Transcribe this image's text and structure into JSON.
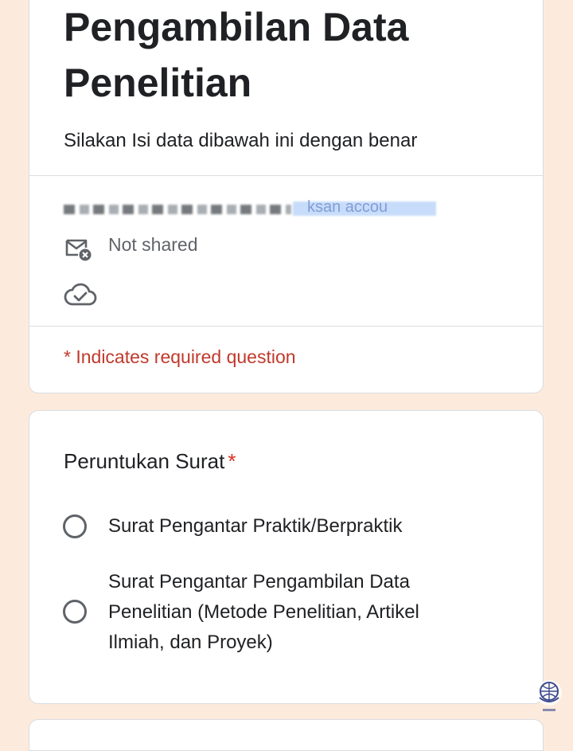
{
  "form": {
    "title": "Pengambilan Data Penelitian",
    "description": "Silakan Isi data dibawah ini dengan benar"
  },
  "account": {
    "email_visible_part": "ksan accou",
    "sharing_status": "Not shared"
  },
  "required_note": "* Indicates required question",
  "question": {
    "title": "Peruntukan Surat",
    "required_marker": "*",
    "options": [
      {
        "label": "Surat Pengantar Praktik/Berpraktik",
        "selected": false
      },
      {
        "label": "Surat Pengantar Pengambilan Data Penelitian (Metode Penelitian, Artikel Ilmiah, dan Proyek)",
        "selected": false
      }
    ]
  },
  "icons": {
    "mail": "mail-off-icon",
    "cloud": "cloud-check-icon",
    "watermark": "university-logo-icon"
  },
  "colors": {
    "background": "#fcebdc",
    "required": "#c0392b",
    "text": "#202124",
    "muted": "#5f6368"
  }
}
